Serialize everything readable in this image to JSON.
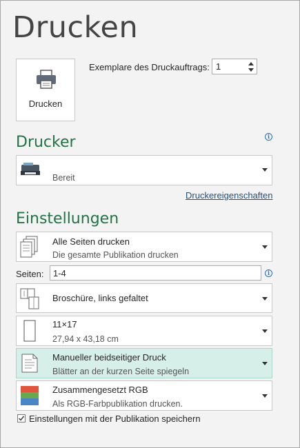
{
  "page": {
    "title": "Drucken"
  },
  "print_button": {
    "label": "Drucken",
    "icon": "printer-icon"
  },
  "copies": {
    "label": "Exemplare des Druckauftrags:",
    "value": "1"
  },
  "printer_section": {
    "heading": "Drucker",
    "printer": {
      "name": "",
      "status": "Bereit",
      "icon": "printer-device-icon"
    },
    "properties_link": "Druckereigenschaften"
  },
  "settings_section": {
    "heading": "Einstellungen",
    "print_range": {
      "main": "Alle Seiten drucken",
      "sub": "Die gesamte Publikation drucken"
    },
    "pages": {
      "label": "Seiten:",
      "value": "1-4"
    },
    "layout": {
      "main": "Broschüre, links gefaltet"
    },
    "paper": {
      "main": "11×17",
      "sub": "27,94 x 43,18 cm"
    },
    "duplex": {
      "main": "Manueller beidseitiger Druck",
      "sub": "Blätter an der kurzen Seite spiegeln"
    },
    "color": {
      "main": "Zusammengesetzt RGB",
      "sub": "Als RGB-Farbpublikation drucken."
    }
  },
  "save_settings": {
    "label": "Einstellungen mit der Publikation speichern",
    "checked": true
  },
  "colors": {
    "accent": "#217346",
    "selected_bg": "#d6efe9",
    "link": "#1f4e79"
  }
}
